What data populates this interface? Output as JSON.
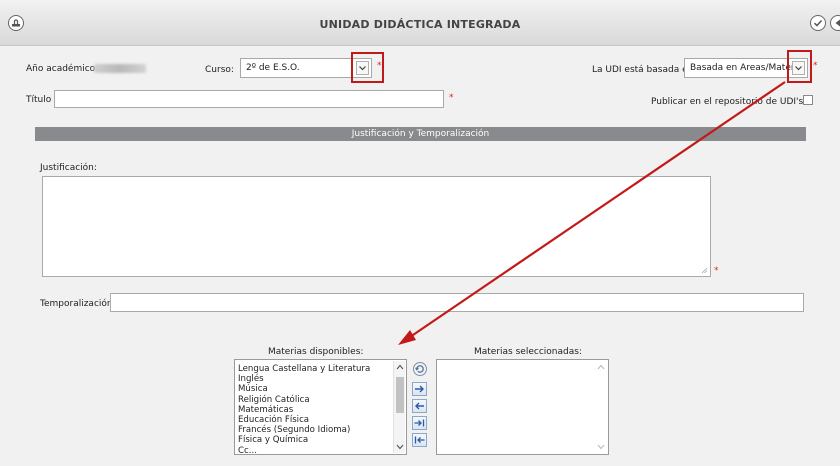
{
  "window": {
    "title": "UNIDAD DIDÁCTICA INTEGRADA"
  },
  "icons": {
    "left": "stamp-icon",
    "confirm": "check-circle-icon",
    "back": "back-arrow-icon"
  },
  "form": {
    "academic_year_label": "Año académico:",
    "academic_year_value_blurred": true,
    "course_label": "Curso:",
    "course_value": "2º de E.S.O.",
    "based_on_label": "La UDI está basada en:",
    "based_on_value": "Basada en Áreas/Materias",
    "title_label": "Título",
    "title_value": "",
    "publish_label": "Publicar en el repositorio de UDI's",
    "publish_checked": false,
    "section_header": "Justificación y Temporalización",
    "justification_label": "Justificación:",
    "justification_value": "",
    "timing_label": "Temporalización:",
    "timing_value": "",
    "required_mark": "*"
  },
  "subjects": {
    "available_label": "Materias disponibles:",
    "selected_label": "Materias seleccionadas:",
    "available": [
      "Lengua Castellana y Literatura",
      "Inglés",
      "Música",
      "Religión Católica",
      "Matemáticas",
      "Educación Física",
      "Francés (Segundo Idioma)",
      "Física y Química",
      "Cc..."
    ],
    "selected": []
  },
  "colors": {
    "annotation_red": "#c21a1a",
    "section_bar": "#888a8d"
  }
}
